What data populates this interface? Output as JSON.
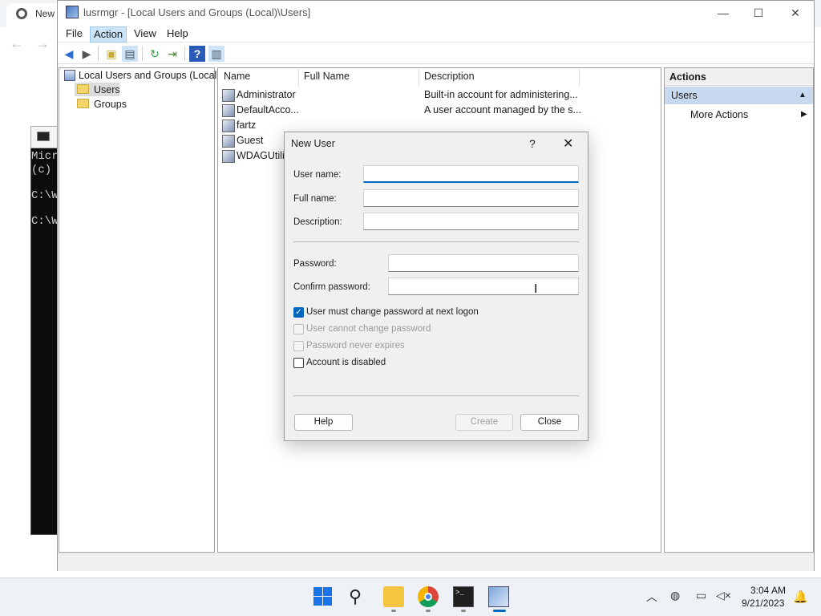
{
  "browser": {
    "tab_label": "New"
  },
  "cmd": {
    "lines": [
      "Micr",
      "(c)",
      "C:\\W",
      "C:\\W"
    ]
  },
  "window": {
    "title": "lusrmgr - [Local Users and Groups (Local)\\Users]"
  },
  "menu": {
    "file": "File",
    "action": "Action",
    "view": "View",
    "help": "Help"
  },
  "tree": {
    "root": "Local Users and Groups (Local)",
    "users": "Users",
    "groups": "Groups"
  },
  "list": {
    "columns": {
      "name": "Name",
      "full_name": "Full Name",
      "description": "Description"
    },
    "rows": [
      {
        "name": "Administrator",
        "full_name": "",
        "description": "Built-in account for administering..."
      },
      {
        "name": "DefaultAcco...",
        "full_name": "",
        "description": "A user account managed by the s..."
      },
      {
        "name": "fartz",
        "full_name": "",
        "description": ""
      },
      {
        "name": "Guest",
        "full_name": "",
        "description": ""
      },
      {
        "name": "WDAGUtilit",
        "full_name": "",
        "description": ""
      }
    ]
  },
  "actions": {
    "header": "Actions",
    "users": "Users",
    "more": "More Actions"
  },
  "dialog": {
    "title": "New User",
    "help_glyph": "?",
    "labels": {
      "username": "User name:",
      "fullname": "Full name:",
      "description": "Description:",
      "password": "Password:",
      "confirm": "Confirm password:"
    },
    "values": {
      "username": "",
      "fullname": "",
      "description": "",
      "password": "",
      "confirm": ""
    },
    "checkboxes": {
      "must_change": {
        "label": "User must change password at next logon",
        "checked": true
      },
      "cannot_change": {
        "label": "User cannot change password",
        "checked": false,
        "disabled": true
      },
      "never_expires": {
        "label": "Password never expires",
        "checked": false,
        "disabled": true
      },
      "disabled": {
        "label": "Account is disabled",
        "checked": false
      }
    },
    "buttons": {
      "help": "Help",
      "create": "Create",
      "close": "Close"
    }
  },
  "taskbar": {
    "time": "3:04 AM",
    "date": "9/21/2023"
  },
  "colors": {
    "accent": "#0067c0",
    "selection": "#c6d9ef"
  }
}
